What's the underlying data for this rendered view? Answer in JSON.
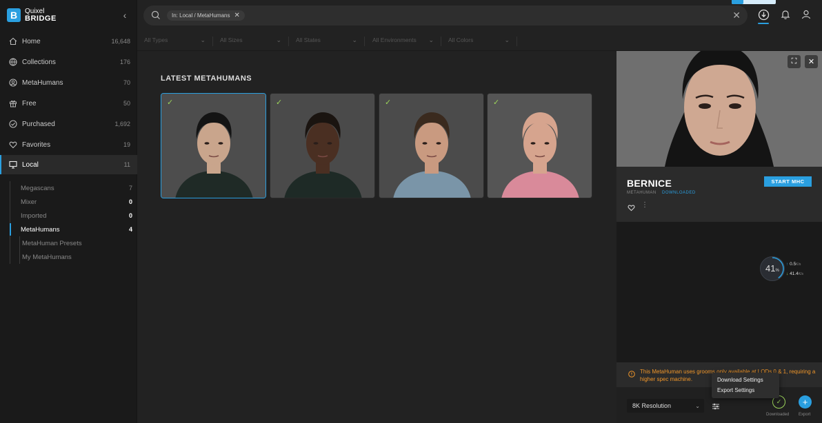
{
  "brand": {
    "line1": "Quixel",
    "line2": "BRIDGE",
    "mark": "B"
  },
  "sidebar": {
    "items": [
      {
        "label": "Home",
        "count": "16,648"
      },
      {
        "label": "Collections",
        "count": "176"
      },
      {
        "label": "MetaHumans",
        "count": "70"
      },
      {
        "label": "Free",
        "count": "50"
      },
      {
        "label": "Purchased",
        "count": "1,692"
      },
      {
        "label": "Favorites",
        "count": "19"
      },
      {
        "label": "Local",
        "count": "11"
      }
    ],
    "local_children": [
      {
        "label": "Megascans",
        "count": "7"
      },
      {
        "label": "Mixer",
        "count": "0"
      },
      {
        "label": "Imported",
        "count": "0"
      },
      {
        "label": "MetaHumans",
        "count": "4"
      }
    ],
    "metahuman_children": [
      "MetaHuman Presets",
      "My MetaHumans"
    ]
  },
  "search": {
    "chip": "In: Local / MetaHumans"
  },
  "filters": [
    "All Types",
    "All Sizes",
    "All States",
    "All Environments",
    "All Colors"
  ],
  "content": {
    "section_title": "LATEST METAHUMANS",
    "cards": [
      {
        "skin": "#c9a58c",
        "hair": "#141414",
        "shirt": "#1f2a26",
        "bg": "#4d4d4d"
      },
      {
        "skin": "#4a2f22",
        "hair": "#1a1410",
        "shirt": "#1e2a26",
        "bg": "#4a4a4a"
      },
      {
        "skin": "#c99a80",
        "hair": "#3a2a1e",
        "shirt": "#7a95a8",
        "bg": "#4b4b4b"
      },
      {
        "skin": "#d6a48e",
        "hair": "#d6a48e",
        "shirt": "#d98a9a",
        "bg": "#555555"
      }
    ]
  },
  "panel": {
    "name": "BERNICE",
    "type": "METAHUMAN",
    "status": "DOWNLOADED",
    "start_button": "START MHC",
    "progress": {
      "percent": "41",
      "unit": "%",
      "up": "0.5",
      "up_unit": "K/s",
      "down": "41.4",
      "down_unit": "K/s"
    },
    "warning": "This MetaHuman uses grooms only available at LODs 0 & 1, requiring a higher spec machine.",
    "menu": [
      "Download Settings",
      "Export Settings"
    ],
    "resolution": "8K Resolution",
    "downloaded_label": "Downloaded",
    "export_label": "Export"
  },
  "colors": {
    "accent": "#2a9fe0",
    "success": "#9bd45a",
    "warning": "#f0962a"
  }
}
